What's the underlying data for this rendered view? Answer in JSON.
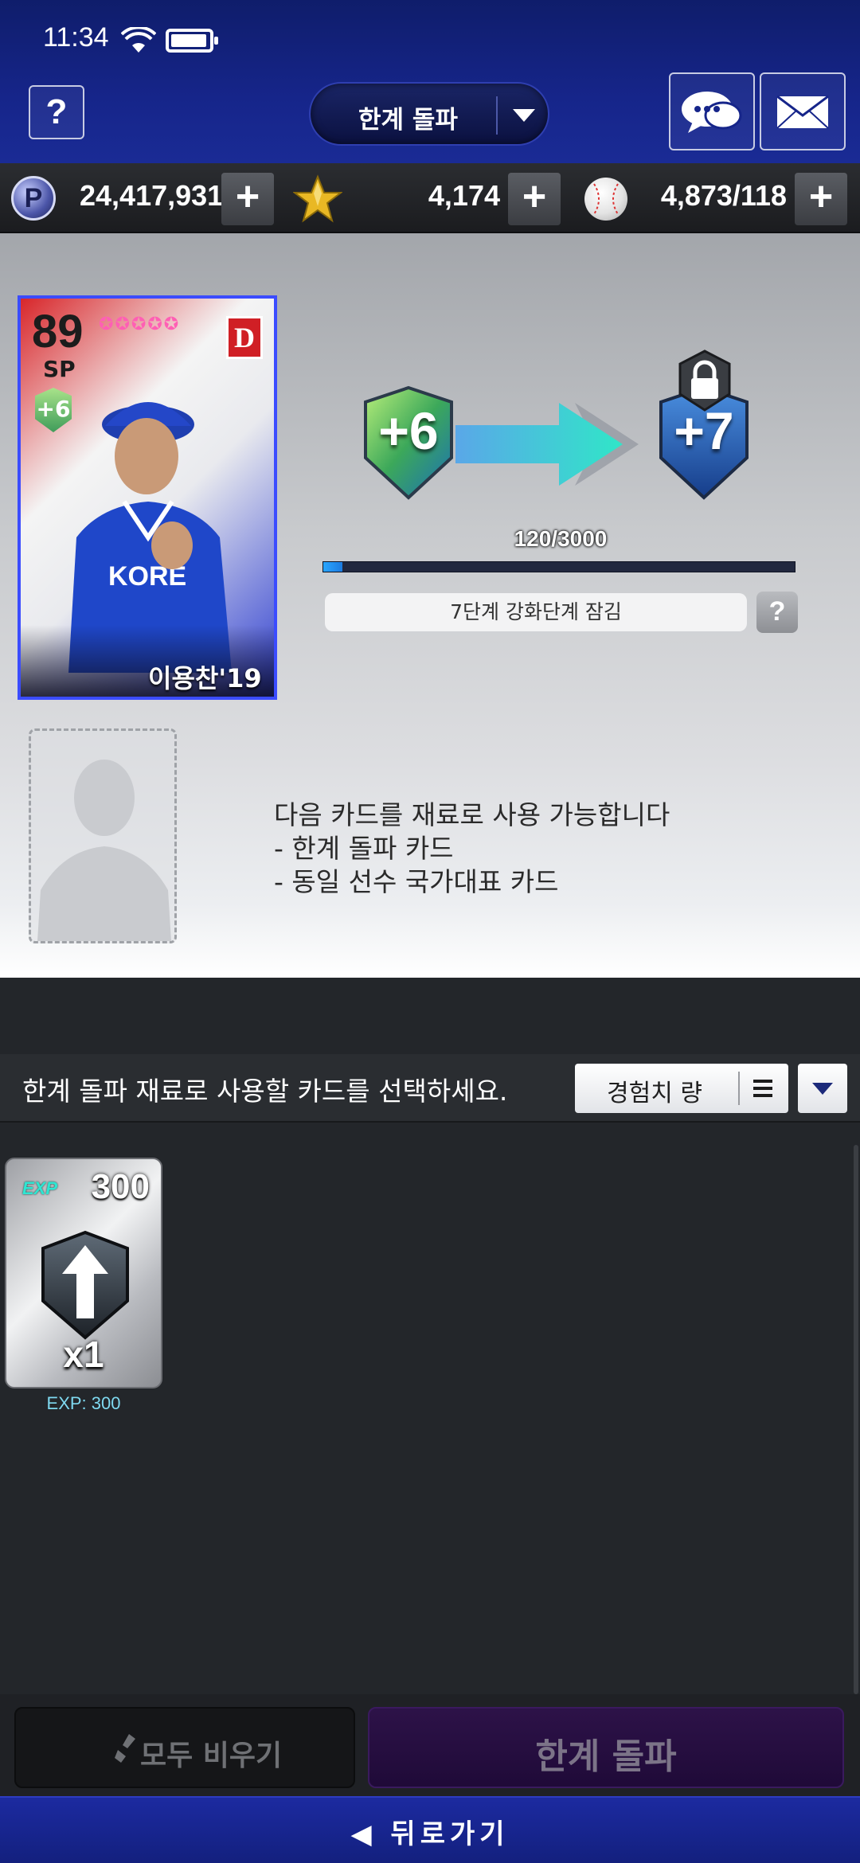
{
  "status": {
    "time": "11:34"
  },
  "header": {
    "help_label": "?",
    "mode_label": "한계 돌파"
  },
  "currency": {
    "points": "24,417,931",
    "points_icon": "P",
    "stars": "4,174",
    "balls": "4,873/118",
    "plus": "+"
  },
  "player_card": {
    "overall": "89",
    "position": "SP",
    "team_letter": "D",
    "enhance_level": "+6",
    "name": "이용찬'19",
    "star_count": 5
  },
  "enhance": {
    "current_level": "+6",
    "next_level": "+7",
    "progress_text": "120/3000",
    "progress_value": 120,
    "progress_max": 3000,
    "lock_note": "7단계 강화단계 잠김",
    "help_label": "?"
  },
  "material_info": {
    "line1": "다음 카드를 재료로 사용 가능합니다",
    "line2": "- 한계 돌파 카드",
    "line3": "- 동일 선수 국가대표 카드"
  },
  "selection": {
    "prompt": "한계 돌파 재료로 사용할 카드를 선택하세요.",
    "sort_label": "경험치 량"
  },
  "materials": [
    {
      "tag": "EXP",
      "amount": "300",
      "qty": "x1",
      "caption": "EXP: 300"
    }
  ],
  "actions": {
    "clear_label": "모두 비우기",
    "break_label": "한계 돌파",
    "back_label": "◀ 뒤로가기"
  },
  "colors": {
    "header_blue": "#16258a",
    "accent_cyan": "#2ee6d2",
    "progress_fill": "#2aa6ff",
    "break_button": "#2d1248"
  }
}
